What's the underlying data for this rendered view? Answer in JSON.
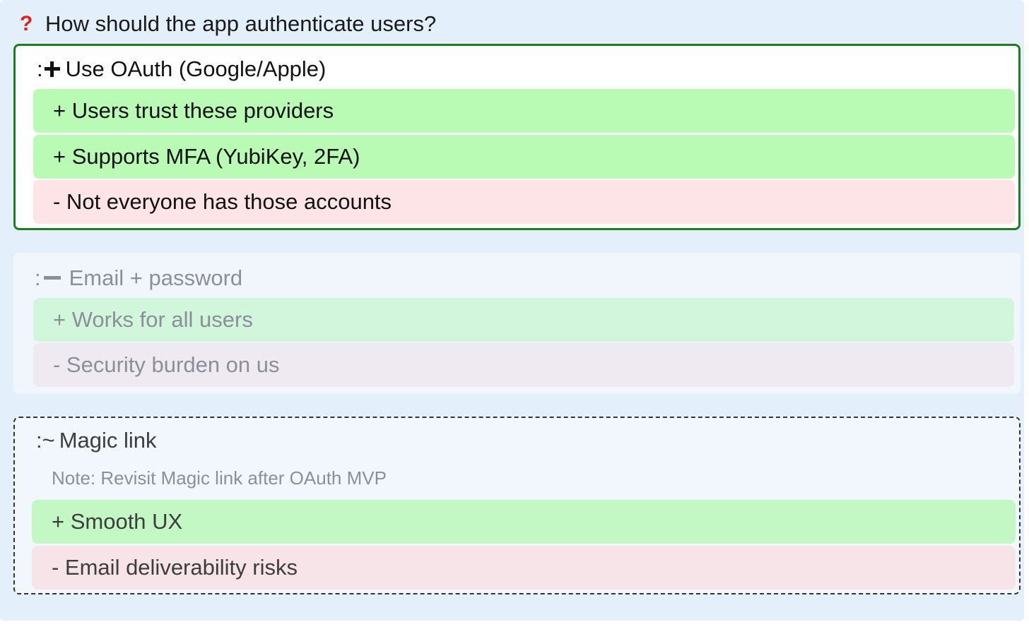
{
  "question": {
    "icon": "question-mark-icon",
    "icon_color": "#e0201b",
    "text": "How should the app authenticate users?"
  },
  "options": [
    {
      "status": "accepted",
      "prefix": ":",
      "status_icon": "plus-icon",
      "title": "Use OAuth (Google/Apple)",
      "border_color": "#1e7d1e",
      "pros": [
        "+ Users trust these providers",
        "+ Supports MFA (YubiKey, 2FA)"
      ],
      "cons": [
        "- Not everyone has those accounts"
      ]
    },
    {
      "status": "rejected",
      "prefix": ":",
      "status_icon": "minus-icon",
      "title": "Email + password",
      "pros": [
        "+ Works for all users"
      ],
      "cons": [
        "- Security burden on us"
      ]
    },
    {
      "status": "deferred",
      "prefix": ":~",
      "title": "Magic link",
      "note": "Note: Revisit Magic link after OAuth MVP",
      "pros": [
        "+ Smooth UX"
      ],
      "cons": [
        "- Email deliverability risks"
      ]
    }
  ],
  "colors": {
    "panel_background": "#e3f0fc",
    "pro_background": "#b9fbb5",
    "con_background": "#fde4e6"
  }
}
